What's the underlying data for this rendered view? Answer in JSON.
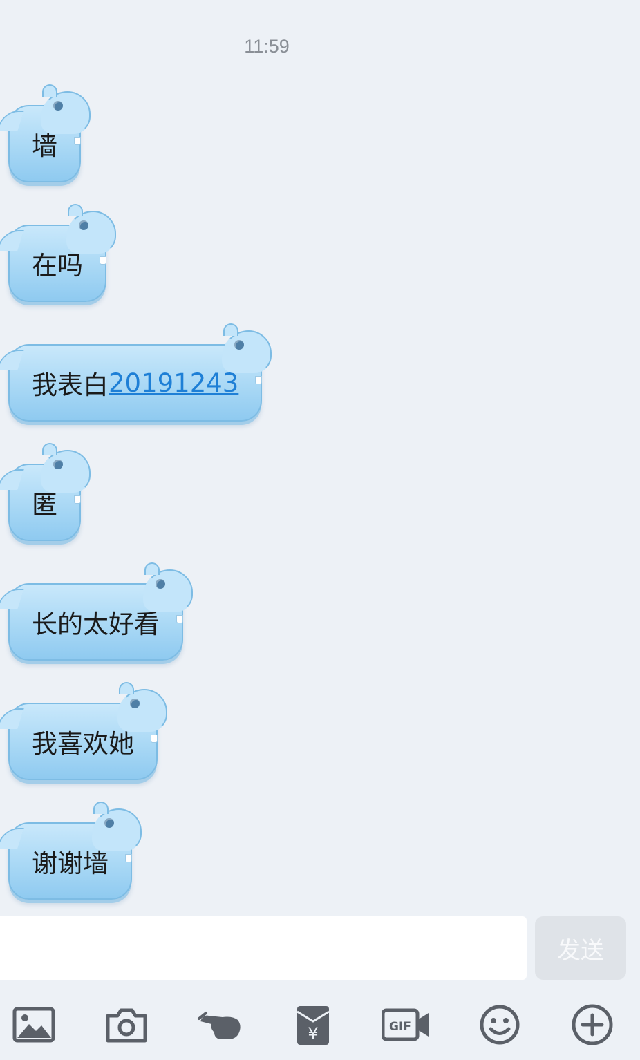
{
  "timestamp": "11:59",
  "messages": [
    {
      "text": "墙",
      "link": ""
    },
    {
      "text": "在吗",
      "link": ""
    },
    {
      "text": "我表白",
      "link": "20191243"
    },
    {
      "text": "匿",
      "link": ""
    },
    {
      "text": "长的太好看",
      "link": ""
    },
    {
      "text": "我喜欢她",
      "link": ""
    },
    {
      "text": "谢谢墙",
      "link": ""
    }
  ],
  "input": {
    "value": "",
    "placeholder": ""
  },
  "send_label": "发送",
  "toolbar": {
    "items": [
      "image-icon",
      "camera-icon",
      "poke-icon",
      "red-packet-icon",
      "gif-icon",
      "emoji-icon",
      "plus-icon"
    ]
  },
  "colors": {
    "background": "#edf1f6",
    "bubble": "#a9d8f5",
    "link": "#1e7fd6",
    "toolbar_icon": "#5b6068"
  }
}
